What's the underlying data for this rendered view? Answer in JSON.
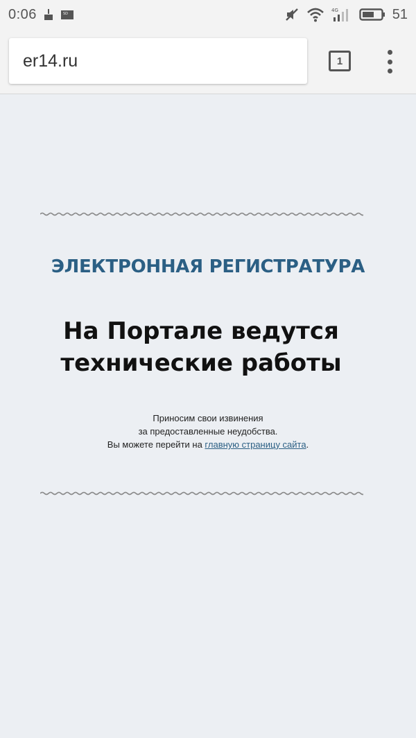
{
  "status_bar": {
    "time": "0:06",
    "battery_level": "51",
    "network_label": "4G",
    "icons": [
      "cleaner-icon",
      "sd-card-icon",
      "muted-icon",
      "wifi-icon",
      "signal-icon",
      "battery-icon"
    ]
  },
  "browser": {
    "url": "er14.ru",
    "tab_count": "1"
  },
  "page": {
    "brand": "ЭЛЕКТРОННАЯ РЕГИСТРАТУРА",
    "headline_line1": "На Портале ведутся",
    "headline_line2": "технические работы",
    "notice_line1": "Приносим свои извинения",
    "notice_line2": "за предоставленные неудобства.",
    "notice_line3_prefix": "Вы можете перейти на ",
    "home_link": "главную страницу сайта",
    "notice_line3_suffix": "."
  },
  "colors": {
    "page_background": "#eceff3",
    "brand": "#2b5f84",
    "headline": "#111111",
    "wave": "#8a8a8a"
  }
}
